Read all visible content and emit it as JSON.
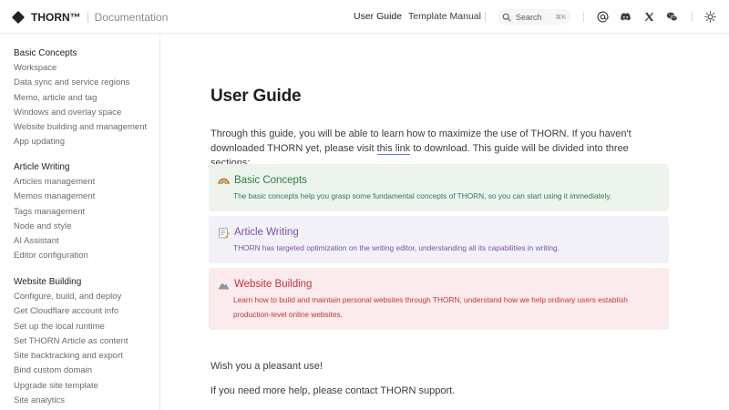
{
  "header": {
    "brand": "THORN™",
    "section": "Documentation",
    "nav": [
      "User Guide",
      "Template Manual"
    ],
    "search": {
      "placeholder": "Search",
      "shortcut": "⌘K"
    },
    "social_icons": [
      "at-icon",
      "discord-icon",
      "x-icon",
      "wechat-icon"
    ],
    "theme_icon": "sun-icon"
  },
  "sidebar": {
    "groups": [
      {
        "title": "Basic Concepts",
        "items": [
          "Workspace",
          "Data sync and service regions",
          "Memo, article and tag",
          "Windows and overlay space",
          "Website building and management",
          "App updating"
        ]
      },
      {
        "title": "Article Writing",
        "items": [
          "Articles management",
          "Memos management",
          "Tags management",
          "Node and style",
          "AI Assistant",
          "Editor configuration"
        ]
      },
      {
        "title": "Website Building",
        "items": [
          "Configure, build, and deploy",
          "Get Cloudflare account info",
          "Set up the local runtime",
          "Set THORN Article as content",
          "Site backtracking and export",
          "Bind custom domain",
          "Upgrade site template",
          "Site analytics"
        ]
      }
    ]
  },
  "main": {
    "title": "User Guide",
    "intro_before": "Through this guide, you will be able to learn how to maximize the use of THORN. If you haven't downloaded THORN yet, please visit ",
    "intro_link": "this link",
    "intro_after": " to download. This guide will be divided into three sections:",
    "cards": [
      {
        "emoji": "🌈",
        "title": "Basic Concepts",
        "desc": "The basic concepts help you grasp some fundamental concepts of THORN, so you can start using it immediately."
      },
      {
        "emoji": "📝",
        "title": "Article Writing",
        "desc": "THORN has targeted optimization on the writing editor, understanding all its capabilities in writing."
      },
      {
        "emoji": "🏔️",
        "title": "Website Building",
        "desc": "Learn how to build and maintain personal websites through THORN, understand how we help ordinary users establish production-level online websites."
      }
    ],
    "outro1": "Wish you a pleasant use!",
    "outro2": "If you need more help, please contact THORN support."
  },
  "colors": {
    "green": "#2f7a4a",
    "purple": "#7654a8",
    "red": "#c0353f",
    "link_underline": "#5b7fd6"
  }
}
